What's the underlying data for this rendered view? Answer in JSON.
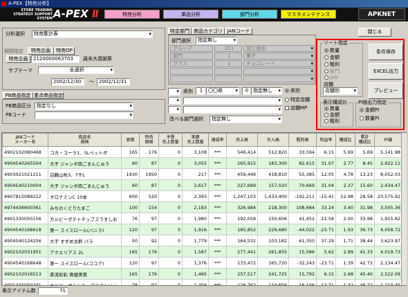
{
  "window": {
    "title": "A-PEX【特売分析】"
  },
  "header": {
    "logo_small": "STORE TRADING STRATEGY SUPPORT SYSTEM",
    "logo_main": "A-PEX",
    "logo_suffix": "Ⅱ",
    "tabs": [
      {
        "label": "特売分析"
      },
      {
        "label": "単品分析"
      },
      {
        "label": "部門分析"
      },
      {
        "label": "マスタメンテナンス"
      }
    ],
    "brand": "APKNET"
  },
  "left": {
    "analysis_label": "分析選択",
    "analysis_value": "特売集計表",
    "period_label": "期間指定",
    "tab1": "特売企画",
    "tab2": "特売OP",
    "plan_button": "特売企画",
    "plan_code": "2120000063703",
    "plan_name": "歳末大感謝祭",
    "sub_label": "サブテーマ",
    "sub_value": "全選択",
    "date_from": "2002/12/30",
    "date_sep": "〜",
    "date_to": "2002/12/31",
    "pb_tab1": "PB商品指定",
    "pb_tab2": "重点商品指定",
    "pb_label1": "PB商品区分",
    "pb_value1": "指定なし",
    "pb_label2": "PBコード"
  },
  "mid": {
    "tabs": [
      "特定部門",
      "商品カテゴリ",
      "JANコード"
    ],
    "dept_label": "部門選択",
    "dept_value": "指定無し",
    "rows": [
      {
        "k": "グループ",
        "c": "211",
        "n": "加工食品"
      },
      {
        "k": "部門",
        "c": "1",
        "n": "菓子"
      },
      {
        "k": "クラス",
        "c": "1",
        "n": "チョコレート"
      }
    ],
    "pref_label": "県別",
    "pref_code": "1",
    "pref_name": "〇〇県",
    "store_code": "0",
    "store_name": "指定無し",
    "radio1": "県別",
    "radio2": "特定店舗",
    "check1": "店舗MP",
    "change_label": "改べる部門選択",
    "change_value": "指定無し"
  },
  "right": {
    "close": "閉じる",
    "print": "条件保存",
    "excel": "EXCEL出力",
    "preview": "プレビュー",
    "sort_title": "ソート指定",
    "sort_opts": [
      "数量",
      "金額",
      "粗利",
      "部門",
      "JAN"
    ],
    "store_label": "店舗",
    "store_value": "店舗別",
    "disp_title": "表示構成比",
    "disp_opts": [
      "数量",
      "金額",
      "粗利"
    ],
    "pi_title": "PI値出力指定",
    "pi_opts": [
      "金額PI",
      "数量PI"
    ]
  },
  "table": {
    "headers": [
      "JANコード\nメーカー名",
      "商品名\n規格",
      "原価",
      "特売\n価格",
      "予想\n売上数量",
      "実績\n売上数量",
      "達成率",
      "売上高",
      "仕入高",
      "粗利高",
      "利益率",
      "構成比",
      "累計\n構成比",
      "PI値"
    ],
    "rows": [
      [
        "4902102080468",
        "コカ・コーラ1．5Lペットボ",
        "165",
        "176",
        "0",
        "3,108",
        "***",
        "546,414",
        "512,820",
        "33,594",
        "6.15",
        "5.69",
        "5.69",
        "5,141.98"
      ],
      [
        "4904540265504",
        "大子 ジャンボ肉ごまんじゅう",
        "60",
        "87",
        "0",
        "3,055",
        "***",
        "265,915",
        "183,300",
        "82,615",
        "31.07",
        "2.77",
        "8.45",
        "2,922.11"
      ],
      [
        "4903021021211",
        "白鶴山吹3．7千L",
        "1930",
        "1950",
        "0",
        "217",
        "***",
        "459,449",
        "418,810",
        "55,385",
        "12.05",
        "4.78",
        "13.23",
        "8,052.03"
      ],
      [
        "4904540210004",
        "大子 ジャンボ肉ごまんじゅう",
        "60",
        "87",
        "0",
        "2,617",
        "***",
        "227,689",
        "157,020",
        "70,669",
        "31.04",
        "2.37",
        "15.60",
        "2,434.47"
      ],
      [
        "4907815089222",
        "オロナミンC 10本",
        "600",
        "520",
        "0",
        "2,393",
        "***",
        "1,247,103",
        "1,433,400",
        "-192,211",
        "-15.41",
        "12.98",
        "28.58",
        "20,575.92"
      ],
      [
        "4974436600361",
        "みちのくどりたまご",
        "100",
        "154",
        "0",
        "2,183",
        "***",
        "326,984",
        "218,300",
        "108,684",
        "33.24",
        "3.40",
        "31.98",
        "3,505.36"
      ],
      [
        "4901330050156",
        "カルビーポテトチップスうすしお",
        "76",
        "97",
        "0",
        "1,980",
        "***",
        "192,058",
        "150,606",
        "41,452",
        "21.58",
        "2.00",
        "33.98",
        "1,915.82"
      ],
      [
        "4904540168618",
        "第一 スイスロール(バニラ)",
        "120",
        "97",
        "0",
        "1,916",
        "***",
        "185,852",
        "229,680",
        "-44,022",
        "-23.71",
        "1.93",
        "36.73",
        "4,058.72"
      ],
      [
        "4904540124256",
        "大子 すずめ太軒 パラ",
        "50",
        "92",
        "0",
        "1,779",
        "***",
        "164,532",
        "103,182",
        "61,350",
        "37.29",
        "1.71",
        "38.44",
        "3,623.97"
      ],
      [
        "4902102031951",
        "アクエリアス 2L",
        "165",
        "176",
        "0",
        "1,587",
        "***",
        "277,441",
        "261,855",
        "15,586",
        "5.62",
        "2.89",
        "41.33",
        "4,019.73"
      ],
      [
        "4904540168648",
        "第一 スイスロール(ココア)",
        "120",
        "97",
        "0",
        "1,376",
        "***",
        "133,472",
        "165,720",
        "-32,243",
        "-23.71",
        "1.39",
        "42.72",
        "2,134.47"
      ],
      [
        "4902102016513",
        "茶流彩彩 爽健美茶",
        "165",
        "176",
        "0",
        "1,465",
        "***",
        "257,517",
        "241,725",
        "15,792",
        "6.15",
        "2.68",
        "45.40",
        "2,522.09"
      ],
      [
        "4901330050201",
        "カルビーポテトチップスコンソメ",
        "78",
        "97",
        "0",
        "1,456",
        "***",
        "126,762",
        "110,656",
        "16,106",
        "12.71",
        "1.32",
        "46.72",
        "1,210.45"
      ]
    ]
  },
  "status": {
    "label": "表示アイテム数",
    "value": "71"
  }
}
